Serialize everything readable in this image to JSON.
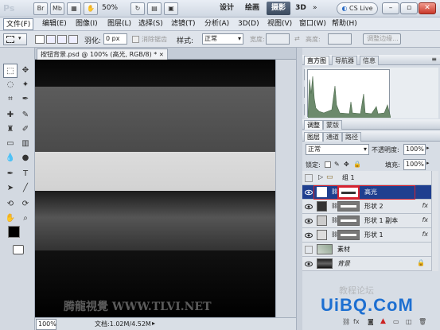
{
  "app": {
    "logo": "Ps",
    "bridge": "Br",
    "minibridge": "Mb",
    "zoom": "50%",
    "workspaces": [
      "设计",
      "绘画",
      "摄影",
      "3D"
    ],
    "active_ws": "摄影",
    "cslive": "CS Live"
  },
  "menu": [
    "文件(F)",
    "编辑(E)",
    "图像(I)",
    "图层(L)",
    "选择(S)",
    "滤镜(T)",
    "分析(A)",
    "3D(D)",
    "视图(V)",
    "窗口(W)",
    "帮助(H)"
  ],
  "options": {
    "feather_label": "羽化:",
    "feather_value": "0 px",
    "anti_alias": "消除锯齿",
    "style_label": "样式:",
    "style_value": "正常",
    "width_label": "宽度:",
    "height_label": "高度:",
    "refine": "调整边缘..."
  },
  "document": {
    "tab": "按钮背景.psd @ 100% (高光, RGB/8) *",
    "zoom": "100%",
    "status": "文档:1.02M/4.52M",
    "watermark": "腾龍視覺 WWW.TLVI.NET"
  },
  "histogram": {
    "tabs": [
      "直方图",
      "导航器",
      "信息"
    ]
  },
  "adjust": {
    "tabs": [
      "调整",
      "蒙版"
    ]
  },
  "layers": {
    "tabs": [
      "图层",
      "通道",
      "路径"
    ],
    "blend": "正常",
    "opacity_label": "不透明度:",
    "opacity": "100%",
    "lock_label": "锁定:",
    "fill_label": "填充:",
    "fill": "100%",
    "rows": [
      {
        "name": "组 1",
        "type": "group"
      },
      {
        "name": "高光",
        "type": "shape",
        "selected": true
      },
      {
        "name": "形状 2",
        "type": "shape",
        "fx": "fx"
      },
      {
        "name": "形状 1 副本",
        "type": "shape",
        "fx": "fx"
      },
      {
        "name": "形状 1",
        "type": "shape",
        "fx": "fx"
      },
      {
        "name": "素材",
        "type": "pixel"
      },
      {
        "name": "背景",
        "type": "bg"
      }
    ]
  },
  "brand": {
    "uibq": "UiBQ.CoM",
    "faint": "教程论坛"
  },
  "colors": {
    "selected": "#1f3f8f",
    "highlight_box": "#d6222f"
  }
}
